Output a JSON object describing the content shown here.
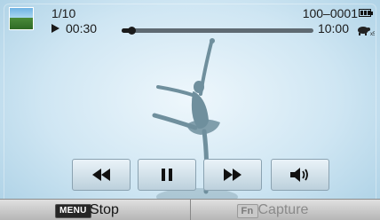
{
  "status": {
    "file_counter": "1/10",
    "elapsed_time": "00:30",
    "file_number": "100–0001",
    "total_time": "10:00",
    "playback_progress": 0.05,
    "speed_icon": "turtle-x5-icon",
    "battery_icon": "battery-full-icon"
  },
  "controls": [
    {
      "name": "rewind-button",
      "icon": "rewind-icon"
    },
    {
      "name": "pause-button",
      "icon": "pause-icon"
    },
    {
      "name": "fast-forward-button",
      "icon": "fast-forward-icon"
    },
    {
      "name": "volume-button",
      "icon": "speaker-icon"
    }
  ],
  "bottom": {
    "menu_key": "MENU",
    "stop_label": "Stop",
    "fn_key": "Fn",
    "capture_label": "Capture"
  },
  "colors": {
    "background": "#cfe6f3",
    "button_face": "#d3e2eb",
    "silhouette": "#6f8f9d",
    "disabled_text": "#8a8a8a"
  }
}
